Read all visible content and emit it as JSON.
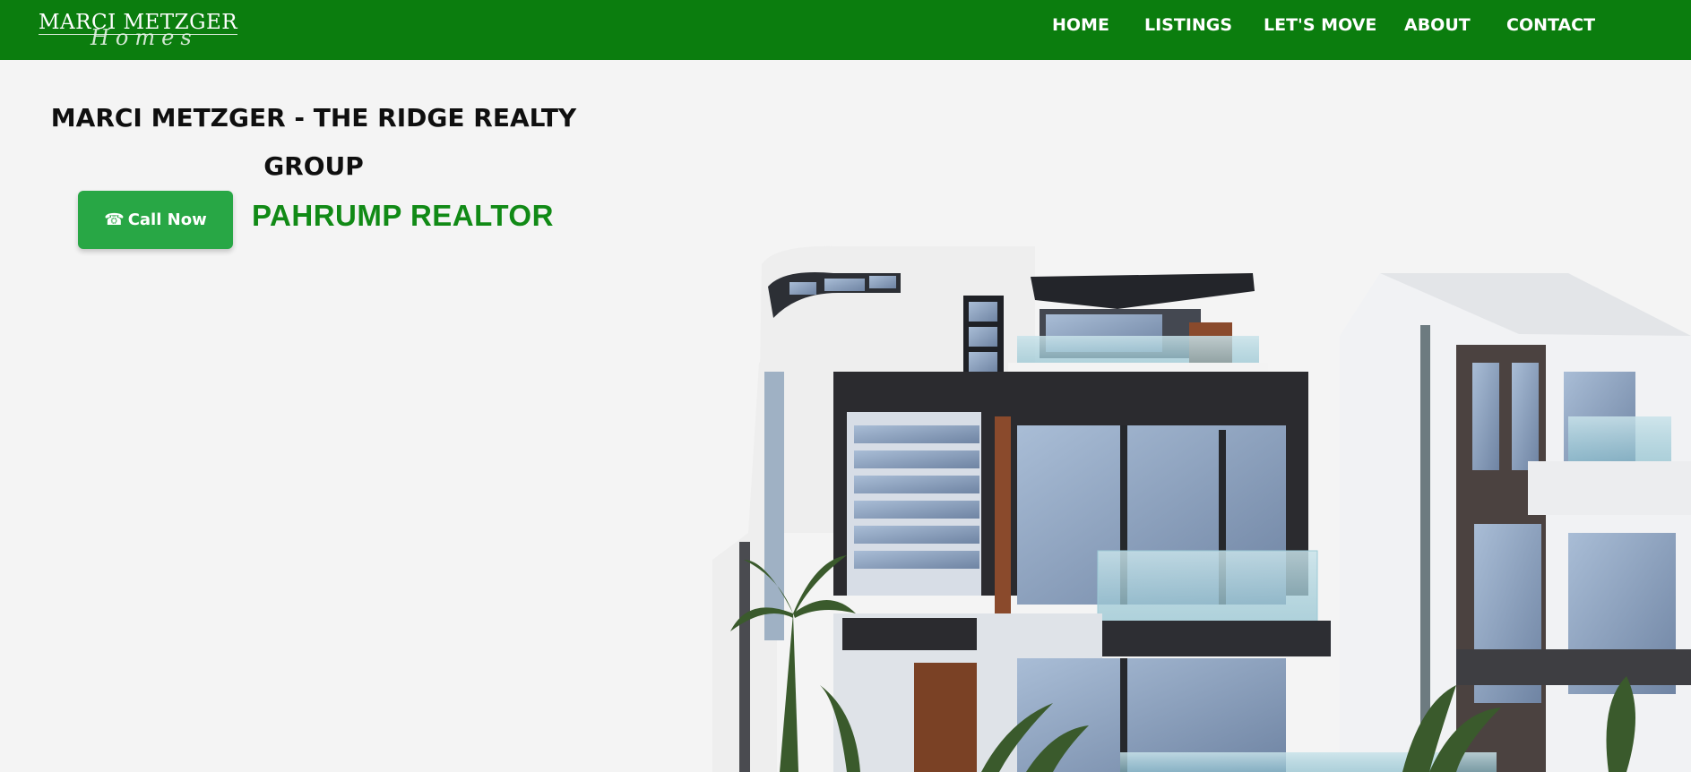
{
  "header": {
    "logo": {
      "main": "MARCI METZGER",
      "script": "Homes"
    },
    "nav": [
      {
        "label": "HOME"
      },
      {
        "label": "LISTINGS"
      },
      {
        "label": "LET'S MOVE"
      },
      {
        "label": "ABOUT"
      },
      {
        "label": "CONTACT"
      }
    ]
  },
  "hero": {
    "title": "MARCI METZGER - THE RIDGE REALTY GROUP",
    "call_button": {
      "icon": "phone-icon",
      "label": "Call Now"
    },
    "tagline": "PAHRUMP REALTOR"
  },
  "colors": {
    "header_bg": "#0b7d0e",
    "button_bg": "#28a745",
    "tagline": "#118a16",
    "page_bg": "#f4f4f4"
  }
}
